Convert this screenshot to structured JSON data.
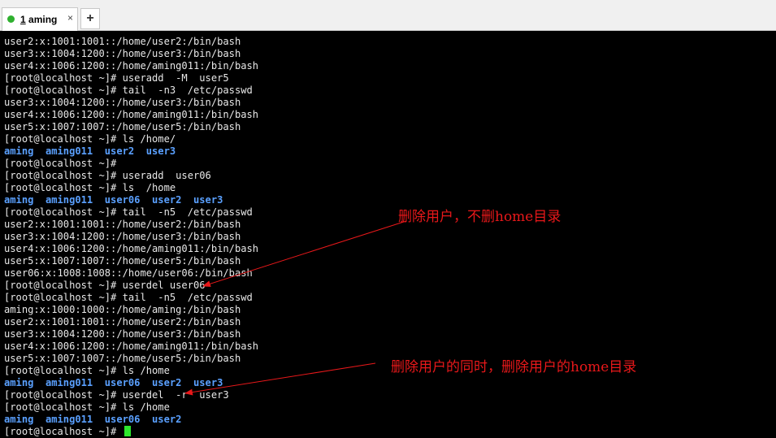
{
  "tabs": [
    {
      "index": "1",
      "label": "aming",
      "active": true
    }
  ],
  "new_tab_label": "+",
  "close_label": "×",
  "terminal": {
    "lines": [
      {
        "text": "user2:x:1001:1001::/home/user2:/bin/bash"
      },
      {
        "text": "user3:x:1004:1200::/home/user3:/bin/bash"
      },
      {
        "text": "user4:x:1006:1200::/home/aming011:/bin/bash"
      },
      {
        "text": "[root@localhost ~]# useradd  -M  user5"
      },
      {
        "text": "[root@localhost ~]# tail  -n3  /etc/passwd"
      },
      {
        "text": "user3:x:1004:1200::/home/user3:/bin/bash"
      },
      {
        "text": "user4:x:1006:1200::/home/aming011:/bin/bash"
      },
      {
        "text": "user5:x:1007:1007::/home/user5:/bin/bash"
      },
      {
        "text": "[root@localhost ~]# ls /home/"
      },
      {
        "text": "aming  aming011  user2  user3",
        "dir": true
      },
      {
        "text": "[root@localhost ~]#"
      },
      {
        "text": "[root@localhost ~]# useradd  user06"
      },
      {
        "text": "[root@localhost ~]# ls  /home"
      },
      {
        "text": "aming  aming011  user06  user2  user3",
        "dir": true
      },
      {
        "text": "[root@localhost ~]# tail  -n5  /etc/passwd"
      },
      {
        "text": "user2:x:1001:1001::/home/user2:/bin/bash"
      },
      {
        "text": "user3:x:1004:1200::/home/user3:/bin/bash"
      },
      {
        "text": "user4:x:1006:1200::/home/aming011:/bin/bash"
      },
      {
        "text": "user5:x:1007:1007::/home/user5:/bin/bash"
      },
      {
        "text": "user06:x:1008:1008::/home/user06:/bin/bash"
      },
      {
        "text": "[root@localhost ~]# userdel user06"
      },
      {
        "text": "[root@localhost ~]# tail  -n5  /etc/passwd"
      },
      {
        "text": "aming:x:1000:1000::/home/aming:/bin/bash"
      },
      {
        "text": "user2:x:1001:1001::/home/user2:/bin/bash"
      },
      {
        "text": "user3:x:1004:1200::/home/user3:/bin/bash"
      },
      {
        "text": "user4:x:1006:1200::/home/aming011:/bin/bash"
      },
      {
        "text": "user5:x:1007:1007::/home/user5:/bin/bash"
      },
      {
        "text": "[root@localhost ~]# ls /home"
      },
      {
        "text": "aming  aming011  user06  user2  user3",
        "dir": true
      },
      {
        "text": "[root@localhost ~]# userdel  -r  user3"
      },
      {
        "text": "[root@localhost ~]# ls /home"
      },
      {
        "text": "aming  aming011  user06  user2",
        "dir": true
      },
      {
        "text": "[root@localhost ~]# ",
        "cursor": true
      }
    ]
  },
  "annotations": {
    "first": "删除用户，不删home目录",
    "second": "删除用户的同时，删除用户的home目录"
  },
  "colors": {
    "terminal_bg": "#000000",
    "terminal_fg": "#e8e8e8",
    "directory": "#5aa0ff",
    "cursor": "#2de82d",
    "annotation": "#e8181a",
    "tab_active_dot": "#2fb02f"
  }
}
